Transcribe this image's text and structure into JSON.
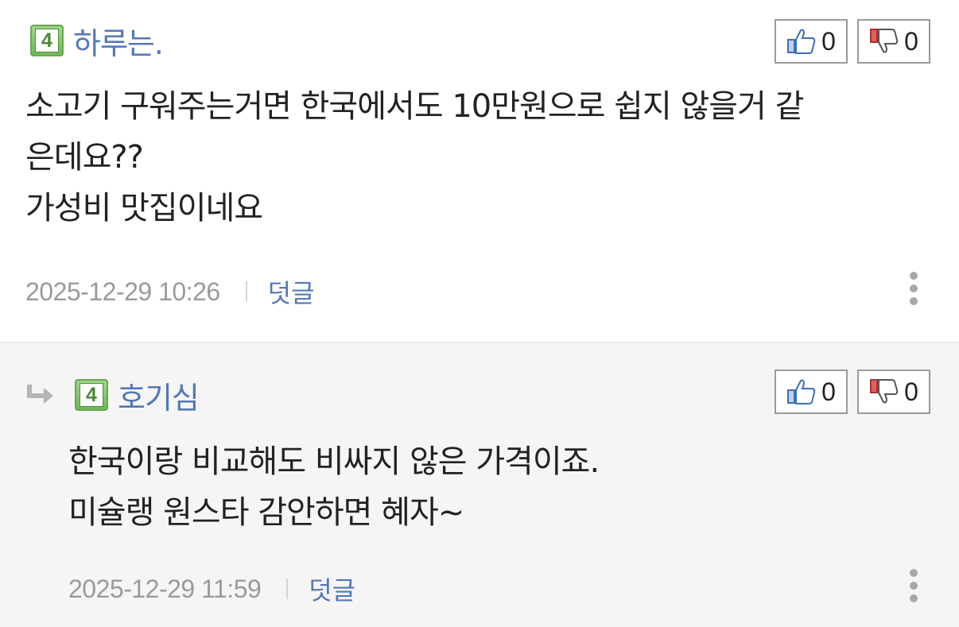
{
  "comments": [
    {
      "level": "4",
      "nickname": "하루는.",
      "likes": "0",
      "dislikes": "0",
      "body_lines": [
        "소고기 구워주는거면 한국에서도 10만원으로 쉽지 않을거 같",
        "은데요??",
        "가성비 맛집이네요"
      ],
      "timestamp": "2025-12-29 10:26",
      "reply_label": "덧글"
    },
    {
      "level": "4",
      "nickname": "호기심",
      "likes": "0",
      "dislikes": "0",
      "body_lines": [
        "한국이랑 비교해도 비싸지 않은 가격이죠.",
        "미슐랭 원스타 감안하면 혜자~"
      ],
      "timestamp": "2025-12-29 11:59",
      "reply_label": "덧글"
    }
  ],
  "icons": {
    "reply_arrow": "reply-arrow-icon",
    "like": "thumbs-up-icon",
    "dislike": "thumbs-down-icon",
    "more": "more-vertical-icon"
  },
  "colors": {
    "nickname": "#5477b8",
    "reply_link": "#5477b8",
    "timestamp": "#9a9a9a",
    "reply_background": "#f5f5f5"
  }
}
